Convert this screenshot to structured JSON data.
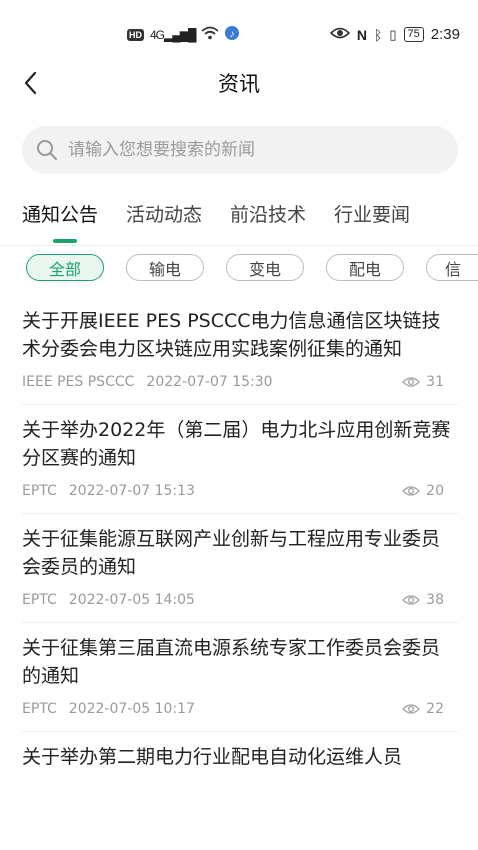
{
  "status_bar": {
    "network": "4G",
    "battery": "75",
    "time": "2:39"
  },
  "header": {
    "title": "资讯"
  },
  "search": {
    "placeholder": "请输入您想要搜索的新闻"
  },
  "tabs": [
    {
      "label": "通知公告",
      "active": true
    },
    {
      "label": "活动动态",
      "active": false
    },
    {
      "label": "前沿技术",
      "active": false
    },
    {
      "label": "行业要闻",
      "active": false
    }
  ],
  "chips": [
    {
      "label": "全部",
      "active": true
    },
    {
      "label": "输电",
      "active": false
    },
    {
      "label": "变电",
      "active": false
    },
    {
      "label": "配电",
      "active": false
    },
    {
      "label": "信",
      "active": false
    }
  ],
  "accent_color": "#1aa36b",
  "news": [
    {
      "title": "关于开展IEEE PES PSCCC电力信息通信区块链技术分委会电力区块链应用实践案例征集的通知",
      "source": "IEEE PES PSCCC",
      "date": "2022-07-07 15:30",
      "views": "31"
    },
    {
      "title": "关于举办2022年（第二届）电力北斗应用创新竞赛分区赛的通知",
      "source": "EPTC",
      "date": "2022-07-07 15:13",
      "views": "20"
    },
    {
      "title": "关于征集能源互联网产业创新与工程应用专业委员会委员的通知",
      "source": "EPTC",
      "date": "2022-07-05 14:05",
      "views": "38"
    },
    {
      "title": "关于征集第三届直流电源系统专家工作委员会委员的通知",
      "source": "EPTC",
      "date": "2022-07-05 10:17",
      "views": "22"
    },
    {
      "title": "关于举办第二期电力行业配电自动化运维人员",
      "source": "",
      "date": "",
      "views": ""
    }
  ]
}
